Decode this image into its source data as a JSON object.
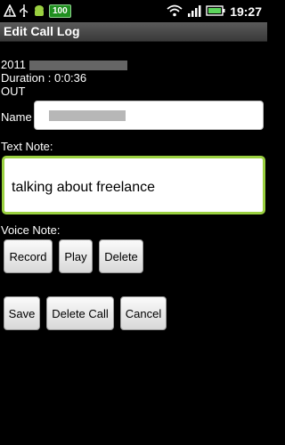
{
  "status_bar": {
    "icons": [
      "warning-icon",
      "usb-icon",
      "android-icon",
      "wifi-icon",
      "signal-icon",
      "battery-icon"
    ],
    "battery_level": "100",
    "time": "19:27"
  },
  "title": "Edit Call Log",
  "call_info": {
    "date": "2011",
    "duration": "Duration : 0:0:36",
    "direction": "OUT"
  },
  "name_label": "Name",
  "text_note_label": "Text Note:",
  "text_note_value": "talking about freelance",
  "voice_note_label": "Voice Note:",
  "voice_buttons": {
    "record": "Record",
    "play": "Play",
    "delete": "Delete"
  },
  "actions": {
    "save": "Save",
    "delete_call": "Delete Call",
    "cancel": "Cancel"
  },
  "colors": {
    "note_border": "#9ad040",
    "background": "#000000"
  }
}
